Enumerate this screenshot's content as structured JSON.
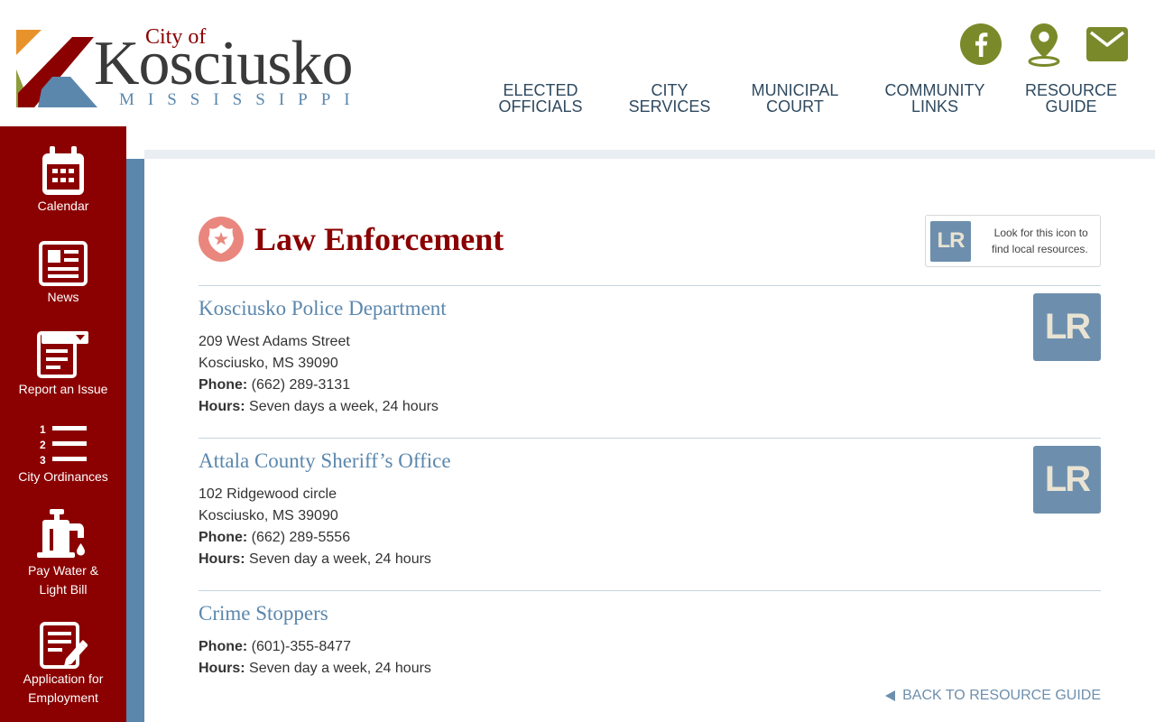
{
  "brand": {
    "city_of": "City of",
    "name": "Kosciusko",
    "state": "MISSISSIPPI"
  },
  "colors": {
    "brand_red": "#8b0000",
    "accent_blue": "#5b87ad",
    "social_olive": "#7a8a2a",
    "badge_salmon": "#e9877e"
  },
  "social": [
    {
      "name": "facebook",
      "icon": "facebook-icon"
    },
    {
      "name": "location",
      "icon": "map-pin-icon"
    },
    {
      "name": "email",
      "icon": "envelope-icon"
    }
  ],
  "topnav": [
    {
      "label": "ELECTED\nOFFICIALS"
    },
    {
      "label": "CITY\nSERVICES"
    },
    {
      "label": "MUNICIPAL\nCOURT"
    },
    {
      "label": "COMMUNITY\nLINKS"
    },
    {
      "label": "RESOURCE\nGUIDE"
    }
  ],
  "sidebar": {
    "items": [
      {
        "label": "Calendar",
        "icon": "calendar-icon"
      },
      {
        "label": "News",
        "icon": "newspaper-icon"
      },
      {
        "label": "Report an Issue",
        "icon": "report-form-icon"
      },
      {
        "label": "City Ordinances",
        "icon": "numbered-list-icon"
      },
      {
        "label": "Pay Water &",
        "label2": "Light Bill",
        "icon": "faucet-icon"
      },
      {
        "label": "Application for",
        "label2": "Employment",
        "icon": "application-form-icon"
      }
    ]
  },
  "page": {
    "title": "Law Enforcement",
    "badge_icon": "police-badge-icon",
    "legend_badge": "LR",
    "legend_text": "Look for this icon to\nfind local resources."
  },
  "entries": [
    {
      "title": "Kosciusko Police Department",
      "address1": "209 West Adams Street",
      "address2": "Kosciusko, MS 39090",
      "phone_label": "Phone:",
      "phone": "(662) 289-3131",
      "hours_label": "Hours:",
      "hours": "Seven days a week, 24 hours",
      "badge": "LR"
    },
    {
      "title": "Attala County Sheriff’s Office",
      "address1": "102 Ridgewood circle",
      "address2": "Kosciusko, MS 39090",
      "phone_label": "Phone:",
      "phone": "(662) 289-5556",
      "hours_label": "Hours:",
      "hours": "Seven day a week, 24 hours",
      "badge": "LR"
    },
    {
      "title": "Crime Stoppers",
      "phone_label": "Phone:",
      "phone": "(601)-355-8477",
      "hours_label": "Hours:",
      "hours": "Seven day a week, 24 hours"
    }
  ],
  "back_link": "BACK TO RESOURCE GUIDE"
}
